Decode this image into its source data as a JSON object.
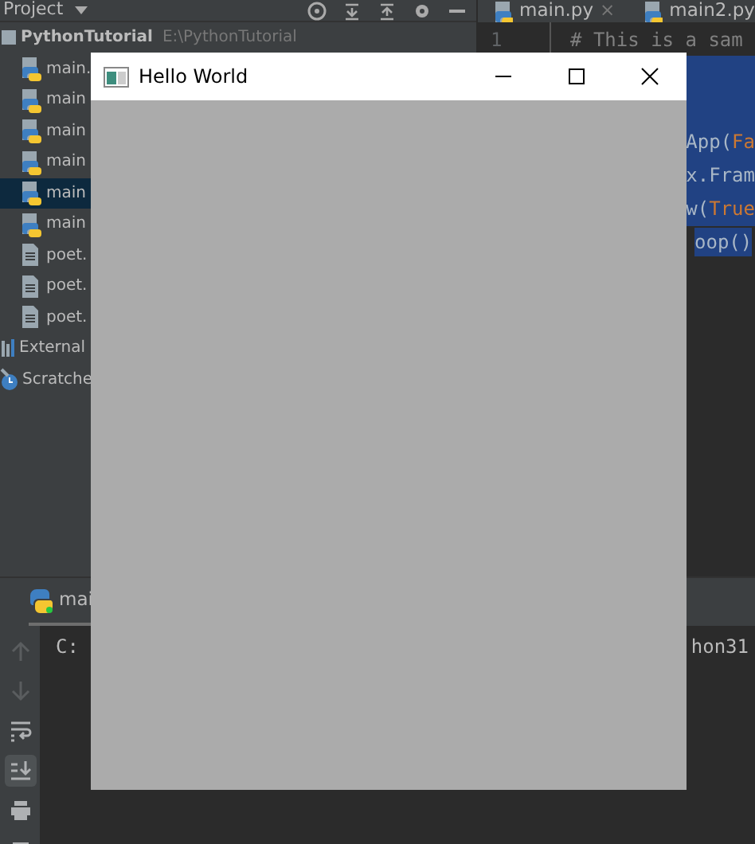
{
  "project_panel": {
    "header": "Project",
    "tree": [
      {
        "label": "PythonTutorial",
        "path": "E:\\PythonTutorial",
        "kind": "folder",
        "selected": false,
        "children": [
          {
            "label": "main.",
            "kind": "python",
            "selected": false
          },
          {
            "label": "main",
            "kind": "python",
            "selected": false
          },
          {
            "label": "main",
            "kind": "python",
            "selected": false
          },
          {
            "label": "main",
            "kind": "python",
            "selected": false
          },
          {
            "label": "main",
            "kind": "python",
            "selected": true
          },
          {
            "label": "main",
            "kind": "python",
            "selected": false
          },
          {
            "label": "poet.",
            "kind": "text",
            "selected": false
          },
          {
            "label": "poet.",
            "kind": "text",
            "selected": false
          },
          {
            "label": "poet.",
            "kind": "text",
            "selected": false
          }
        ]
      },
      {
        "label": "External",
        "kind": "library",
        "selected": false
      },
      {
        "label": "Scratche",
        "kind": "scratches",
        "selected": false
      }
    ]
  },
  "editor_tabs": [
    {
      "label": "main.py",
      "close": "×"
    },
    {
      "label": "main2.py"
    }
  ],
  "editor": {
    "lines": [
      {
        "number": "1",
        "segments": [
          {
            "text": "# This is a sam",
            "kind": "comment"
          }
        ],
        "selected": false
      },
      {
        "selected": true
      },
      {
        "selected": true
      },
      {
        "segments": [
          {
            "text": "App(",
            "kind": "plain"
          },
          {
            "text": "Fa",
            "kind": "keyword"
          }
        ],
        "selected": true
      },
      {
        "segments": [
          {
            "text": "x.Fram",
            "kind": "plain"
          }
        ],
        "selected": true
      },
      {
        "segments": [
          {
            "text": "w(",
            "kind": "plain"
          },
          {
            "text": "True",
            "kind": "keyword"
          }
        ],
        "selected": true
      },
      {
        "segments": [
          {
            "text": "oop()",
            "kind": "plain"
          }
        ],
        "selected": true,
        "selection_ends_at_text": true
      }
    ]
  },
  "run_panel": {
    "tab": "mai",
    "toolbar": [
      {
        "kind": "up",
        "disabled": true
      },
      {
        "kind": "down",
        "disabled": true
      },
      {
        "kind": "wrap",
        "selected": false
      },
      {
        "kind": "scroll_end",
        "selected": true
      },
      {
        "kind": "print",
        "selected": false
      },
      {
        "kind": "trash",
        "selected": false
      }
    ],
    "console_lines": [
      {
        "left": "C:",
        "right": "hon31"
      }
    ]
  },
  "window": {
    "title": "Hello World"
  }
}
